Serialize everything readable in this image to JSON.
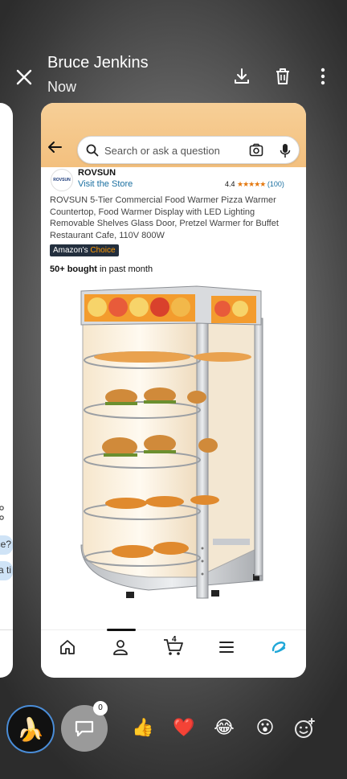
{
  "header": {
    "title": "Bruce Jenkins",
    "subtitle": "Now",
    "icons": [
      "close-icon",
      "download-icon",
      "trash-icon",
      "more-vert-icon"
    ]
  },
  "side_card": {
    "snippet_1": "ce?",
    "snippet_2": "a ti"
  },
  "app": {
    "search_placeholder": "Search or ask a question",
    "seller": {
      "logo_text": "ROVSUN",
      "name": "ROVSUN",
      "visit_label": "Visit the Store"
    },
    "rating": {
      "value": "4.4",
      "stars": "★★★★★",
      "count": "(100)"
    },
    "product_title": "ROVSUN 5-Tier Commercial Food Warmer Pizza Warmer Countertop, Food Warmer Display with LED Lighting Removable Shelves Glass Door, Pretzel Warmer for Buffet Restaurant Cafe, 110V 800W",
    "badge": {
      "part1": "Amazon's",
      "part2": "Choice"
    },
    "bought": {
      "bold": "50+ bought",
      "rest": " in past month"
    },
    "cart_count": "4",
    "nav_items": [
      "home-icon",
      "profile-icon",
      "cart-icon",
      "menu-icon",
      "rufus-icon"
    ],
    "colors": {
      "header_orange": "#f3c07e",
      "link_blue": "#1a6fa0",
      "star_orange": "#e47911",
      "choice_bg": "#232f3e"
    }
  },
  "bottom_bar": {
    "avatar_emoji": "🍌",
    "comment_count": "0",
    "reactions": [
      "👍",
      "❤️",
      "😂",
      "😮"
    ],
    "add_reaction_icon": "add-reaction-icon"
  }
}
